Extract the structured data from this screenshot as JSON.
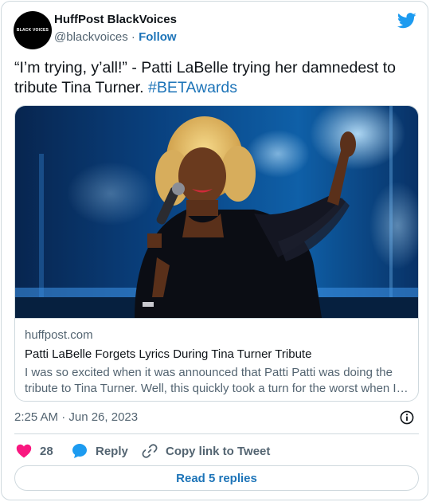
{
  "author": {
    "name": "HuffPost BlackVoices",
    "handle": "@blackvoices",
    "separator": " · ",
    "follow_label": "Follow",
    "avatar_text": "BLACK VOICES"
  },
  "tweet": {
    "text": "“I’m trying, y’all!” - Patti LaBelle trying her damnedest to tribute Tina Turner. ",
    "hashtag": "#BETAwards"
  },
  "link_card": {
    "domain": "huffpost.com",
    "title": "Patti LaBelle Forgets Lyrics During Tina Turner Tribute",
    "description": "I was so excited when it was announced that Patti Patti was doing the tribute to Tina Turner. Well, this quickly took a turn for the worst when I …",
    "image_icon": "performer-photo"
  },
  "meta": {
    "timestamp": "2:25 AM · Jun 26, 2023",
    "info_icon": "info-icon"
  },
  "actions": {
    "like_count": "28",
    "reply_label": "Reply",
    "copy_label": "Copy link to Tweet",
    "read_replies_label": "Read 5 replies"
  },
  "colors": {
    "link": "#1d74b8",
    "twitter_blue": "#1d9bf0",
    "heart": "#f91880",
    "muted": "#536471",
    "border": "#cfd9de"
  }
}
